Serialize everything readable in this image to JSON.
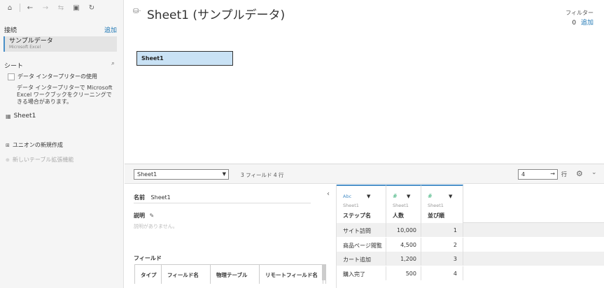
{
  "toolbar": {
    "icons": [
      "home-icon",
      "back-icon",
      "forward-icon",
      "connect-icon",
      "save-icon",
      "refresh-icon"
    ]
  },
  "left": {
    "connections_title": "接続",
    "connections_add": "追加",
    "connection": {
      "name": "サンプルデータ",
      "type": "Microsoft Excel"
    },
    "sheets_title": "シート",
    "interpreter_label": "データ インタープリターの使用",
    "interpreter_desc": "データ インタープリターで Microsoft Excel ワークブックをクリーニングできる場合があります。",
    "sheet_name": "Sheet1",
    "union_label": "ユニオンの新規作成",
    "extension_label": "新しいテーブル拡張機能"
  },
  "canvas": {
    "title": "Sheet1 (サンプルデータ)",
    "filter_label": "フィルター",
    "filter_count": "0",
    "filter_add": "追加",
    "table_name": "Sheet1"
  },
  "bottombar": {
    "selected_table": "Sheet1",
    "fields_summary": "3 フィールド 4 行",
    "rows_value": "4",
    "rows_label": "行"
  },
  "meta": {
    "name_key": "名前",
    "name_value": "Sheet1",
    "desc_key": "説明",
    "desc_empty": "説明がありません。",
    "fields_key": "フィールド",
    "columns": [
      "タイプ",
      "フィールド名",
      "物理テーブル",
      "リモートフィールド名"
    ]
  },
  "grid": {
    "columns": [
      {
        "type": "Abc",
        "source": "Sheet1",
        "name": "ステップ名"
      },
      {
        "type": "#",
        "source": "Sheet1",
        "name": "人数"
      },
      {
        "type": "#",
        "source": "Sheet1",
        "name": "並び順"
      }
    ],
    "rows": [
      [
        "サイト訪問",
        "10,000",
        "1"
      ],
      [
        "商品ページ閲覧",
        "4,500",
        "2"
      ],
      [
        "カート追加",
        "1,200",
        "3"
      ],
      [
        "購入完了",
        "500",
        "4"
      ]
    ]
  }
}
